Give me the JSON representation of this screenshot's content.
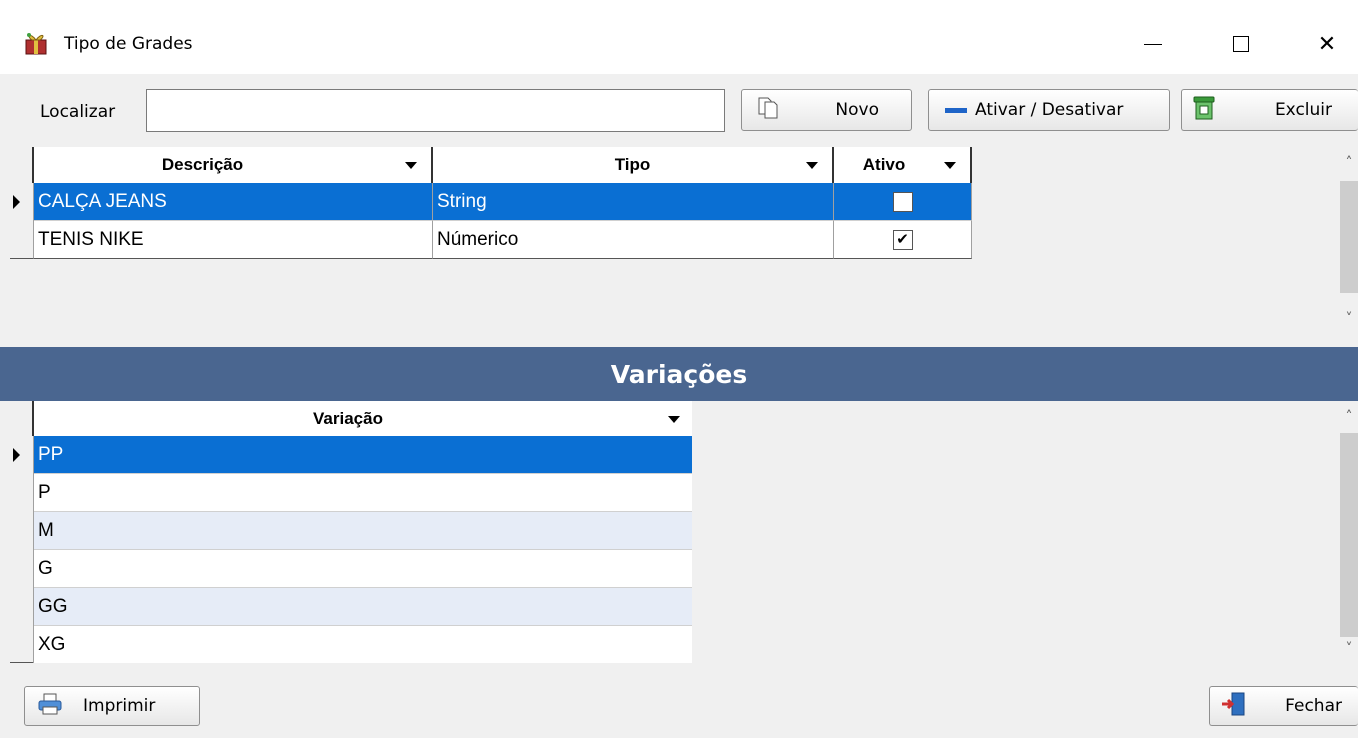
{
  "window": {
    "title": "Tipo de Grades",
    "icon": "gift-box-icon",
    "controls": {
      "minimize": "minimize-icon",
      "maximize": "maximize-icon",
      "close": "✕"
    }
  },
  "toolbar": {
    "search_label": "Localizar",
    "search_value": "",
    "novo_label": "Novo",
    "ativar_label": "Ativar / Desativar",
    "excluir_label": "Excluir"
  },
  "grades": {
    "columns": [
      "Descrição",
      "Tipo",
      "Ativo"
    ],
    "rows": [
      {
        "descricao": "CALÇA JEANS",
        "tipo": "String",
        "ativo": false,
        "selected": true
      },
      {
        "descricao": "TENIS NIKE",
        "tipo": "Númerico",
        "ativo": true,
        "selected": false
      }
    ]
  },
  "variacoes": {
    "section_title": "Variações",
    "column": "Variação",
    "rows": [
      "PP",
      "P",
      "M",
      "G",
      "GG",
      "XG"
    ],
    "selected_index": 0
  },
  "footer": {
    "imprimir_label": "Imprimir",
    "fechar_label": "Fechar"
  },
  "colors": {
    "selection": "#0a6fd3",
    "section_header": "#4a6690",
    "alt_row": "#e6ecf7",
    "accent_blue": "#1e64c8"
  }
}
